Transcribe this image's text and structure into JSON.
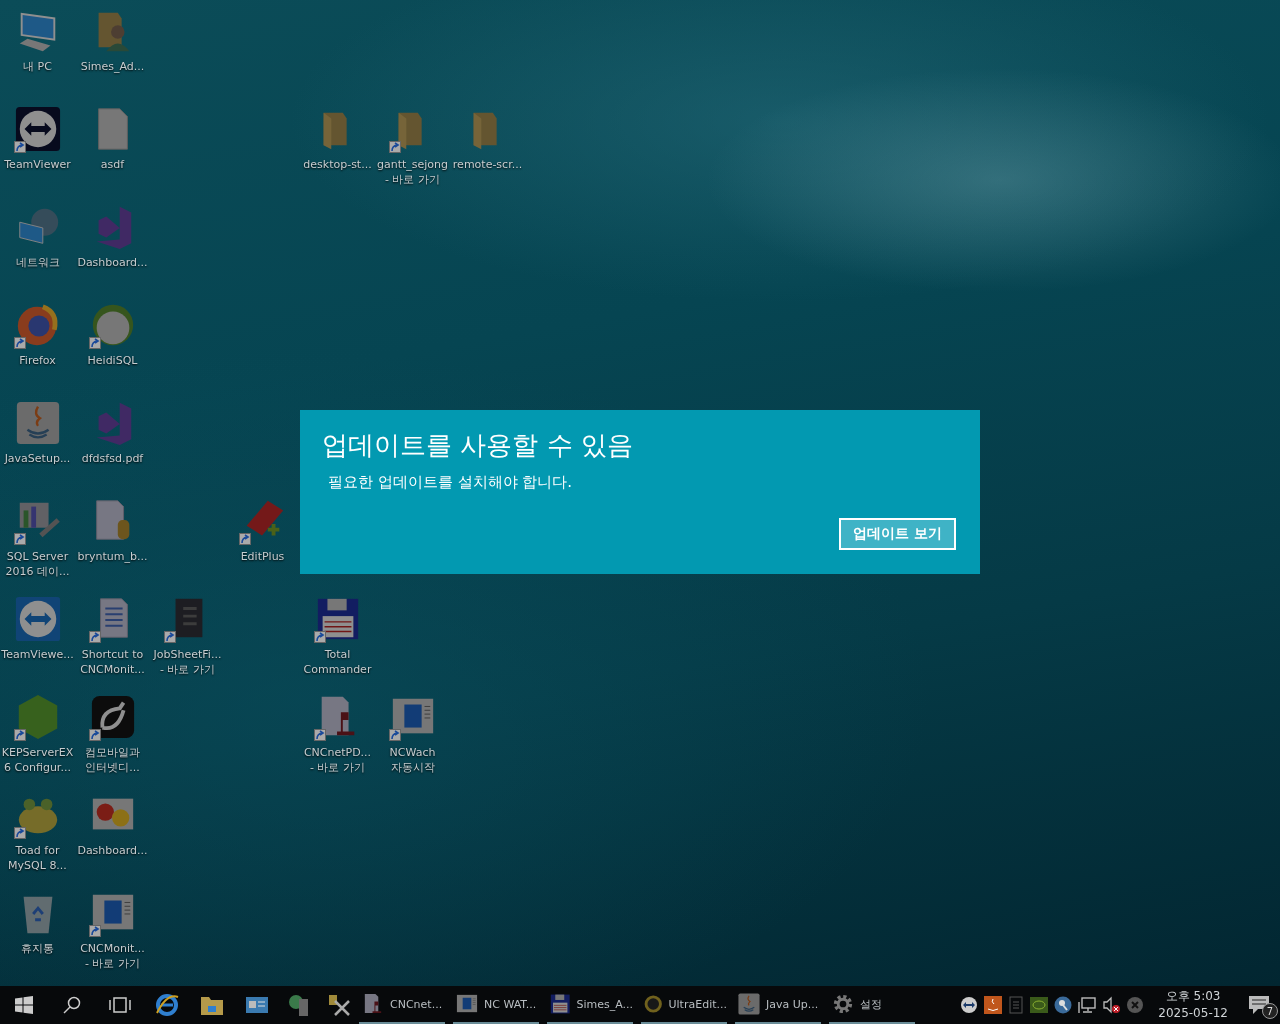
{
  "desktop": {
    "icons": [
      {
        "kind": "pc",
        "label": [
          "내 PC"
        ],
        "shortcut": false
      },
      {
        "kind": "userfolder",
        "label": [
          "Simes_Ad..."
        ],
        "shortcut": false
      },
      {
        "kind": "teamviewer",
        "label": [
          "TeamViewer"
        ],
        "shortcut": true
      },
      {
        "kind": "file",
        "label": [
          "asdf"
        ],
        "shortcut": false
      },
      {
        "kind": "folder",
        "label": [
          "desktop-st..."
        ],
        "shortcut": false
      },
      {
        "kind": "folder",
        "label": [
          "gantt_sejong",
          "- 바로 가기"
        ],
        "shortcut": true
      },
      {
        "kind": "folder",
        "label": [
          "remote-scr..."
        ],
        "shortcut": false
      },
      {
        "kind": "network",
        "label": [
          "네트워크"
        ],
        "shortcut": false
      },
      {
        "kind": "vs",
        "label": [
          "Dashboard..."
        ],
        "shortcut": false
      },
      {
        "kind": "firefox",
        "label": [
          "Firefox"
        ],
        "shortcut": true
      },
      {
        "kind": "heidisql",
        "label": [
          "HeidiSQL"
        ],
        "shortcut": true
      },
      {
        "kind": "java",
        "label": [
          "JavaSetup..."
        ],
        "shortcut": false
      },
      {
        "kind": "vs",
        "label": [
          "dfdsfsd.pdf"
        ],
        "shortcut": false
      },
      {
        "kind": "sqlserver",
        "label": [
          "SQL Server",
          "2016 데이..."
        ],
        "shortcut": true
      },
      {
        "kind": "dbfile",
        "label": [
          "bryntum_b..."
        ],
        "shortcut": false
      },
      {
        "kind": "editplus",
        "label": [
          "EditPlus"
        ],
        "shortcut": true
      },
      {
        "kind": "teamviewer2",
        "label": [
          "TeamViewe..."
        ],
        "shortcut": false
      },
      {
        "kind": "document",
        "label": [
          "Shortcut to",
          "CNCMonit..."
        ],
        "shortcut": true
      },
      {
        "kind": "darkdoc",
        "label": [
          "JobSheetFi...",
          "- 바로 가기"
        ],
        "shortcut": true
      },
      {
        "kind": "floppy",
        "label": [
          "Total",
          "Commander"
        ],
        "shortcut": true
      },
      {
        "kind": "kep",
        "label": [
          "KEPServerEX",
          "6 Configur..."
        ],
        "shortcut": true
      },
      {
        "kind": "blackapp",
        "label": [
          "컴모바일과",
          "인터넷디..."
        ],
        "shortcut": true
      },
      {
        "kind": "cncnet",
        "label": [
          "CNCnetPD...",
          "- 바로 가기"
        ],
        "shortcut": true
      },
      {
        "kind": "window",
        "label": [
          "NCWach",
          "자동시작"
        ],
        "shortcut": true
      },
      {
        "kind": "toad",
        "label": [
          "Toad for",
          "MySQL 8..."
        ],
        "shortcut": true
      },
      {
        "kind": "picture",
        "label": [
          "Dashboard..."
        ],
        "shortcut": false
      },
      {
        "kind": "recycle",
        "label": [
          "휴지통"
        ],
        "shortcut": false
      },
      {
        "kind": "window",
        "label": [
          "CNCMonit...",
          "- 바로 가기"
        ],
        "shortcut": true
      }
    ]
  },
  "notification": {
    "title": "업데이트를 사용할 수 있음",
    "message": "필요한 업데이트를 설치해야 합니다.",
    "button": "업데이트 보기"
  },
  "taskbar": {
    "apps": [
      {
        "kind": "cncnet",
        "label": "CNCnet..."
      },
      {
        "kind": "window",
        "label": "NC WAT..."
      },
      {
        "kind": "floppy",
        "label": "Simes_A..."
      },
      {
        "kind": "ultraedit",
        "label": "UltraEdit..."
      },
      {
        "kind": "java",
        "label": "Java Up..."
      },
      {
        "kind": "gear",
        "label": "설정"
      }
    ],
    "clock": {
      "time": "오후 5:03",
      "date": "2025-05-12"
    },
    "notification_count": "7"
  }
}
